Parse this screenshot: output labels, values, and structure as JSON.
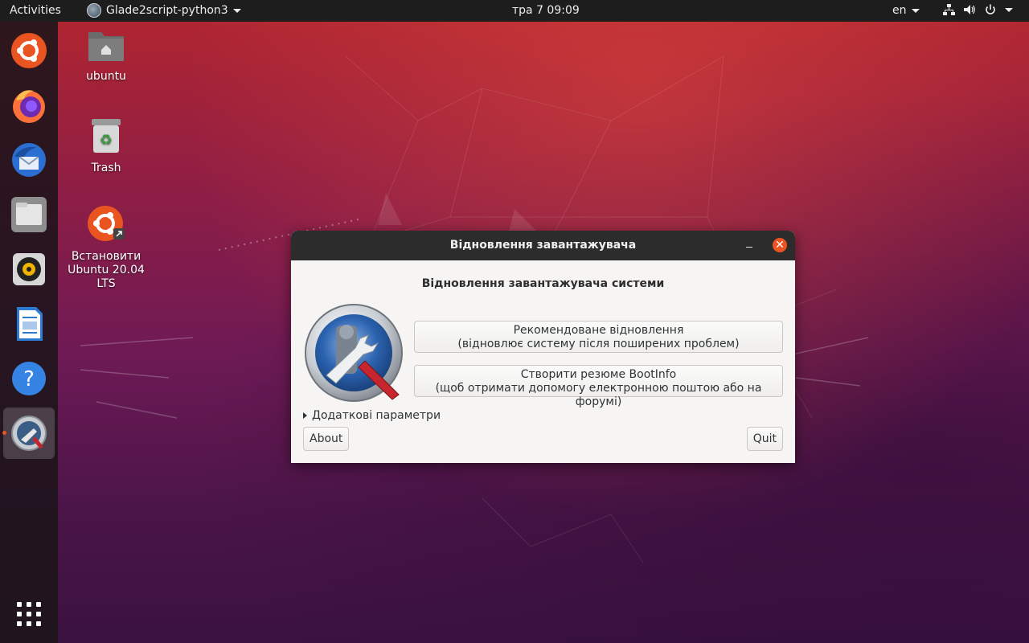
{
  "topbar": {
    "activities": "Activities",
    "app_name": "Glade2script-python3",
    "clock": "тра 7  09:09",
    "language": "en"
  },
  "dock": {
    "items": [
      {
        "icon": "ubuntu-installer-icon"
      },
      {
        "icon": "firefox-icon"
      },
      {
        "icon": "thunderbird-icon"
      },
      {
        "icon": "files-icon"
      },
      {
        "icon": "rhythmbox-icon"
      },
      {
        "icon": "libreoffice-writer-icon"
      },
      {
        "icon": "help-icon"
      },
      {
        "icon": "boot-repair-icon"
      },
      {
        "icon": "show-applications-icon"
      }
    ]
  },
  "desktop": {
    "home_label": "ubuntu",
    "trash_label": "Trash",
    "install_label": "Встановити Ubuntu 20.04 LTS"
  },
  "dialog": {
    "title": "Відновлення завантажувача",
    "heading": "Відновлення завантажувача системи",
    "recommended_line1": "Рекомендоване відновлення",
    "recommended_line2": "(відновлює систему після поширених проблем)",
    "bootinfo_line1": "Створити резюме BootInfo",
    "bootinfo_line2": "(щоб отримати допомогу електронною поштою або на форумі)",
    "advanced": "Додаткові параметри",
    "about": "About",
    "quit": "Quit"
  },
  "colors": {
    "accent": "#e95420",
    "topbar": "#1d1d1d",
    "dialog_bg": "#f6f5f4",
    "titlebar": "#2c2c2c"
  }
}
